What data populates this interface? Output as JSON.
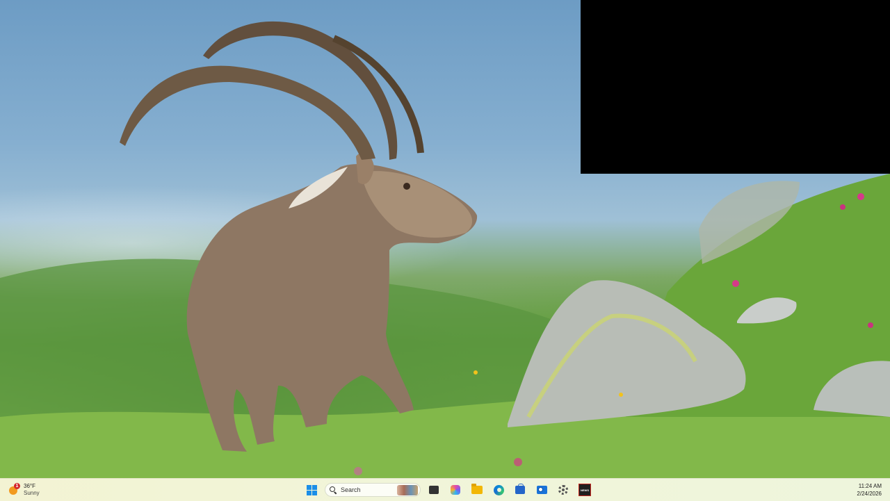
{
  "desktop": {
    "wallpaper_subject": "ibex"
  },
  "taskbar": {
    "weather": {
      "temperature": "36°F",
      "condition": "Sunny",
      "alert_count": "1"
    },
    "search": {
      "placeholder": "Search"
    },
    "pinned": [
      {
        "name": "start-icon"
      },
      {
        "name": "task-view-icon"
      },
      {
        "name": "copilot-icon"
      },
      {
        "name": "file-explorer-icon"
      },
      {
        "name": "edge-icon"
      },
      {
        "name": "microsoft-store-icon"
      },
      {
        "name": "outlook-icon"
      },
      {
        "name": "settings-icon"
      },
      {
        "name": "news-app-icon",
        "label": "NEWS"
      }
    ],
    "clock": {
      "time": "11:24 AM",
      "date": "2/24/2026"
    }
  },
  "colors": {
    "taskbar_bg": "#f1f5d9",
    "overlay": "#000000",
    "accent": "#1b8ee8"
  }
}
